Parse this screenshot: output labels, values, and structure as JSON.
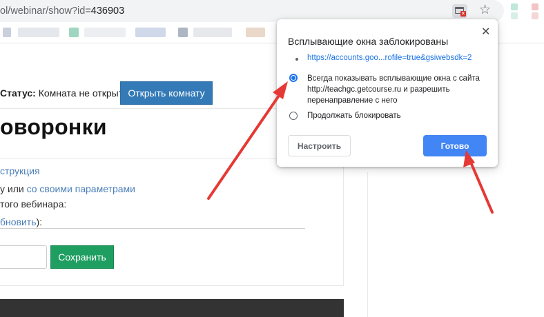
{
  "browser": {
    "url_prefix": "ol/webinar/show?id=",
    "url_id": "436903",
    "popup_icon": "popup-blocked-icon",
    "star_icon": "star-icon"
  },
  "page": {
    "status_label": "Статус:",
    "status_value": "Комната не открыта",
    "open_room_button": "Открыть комнату",
    "title": "оворонки",
    "instruction_link": "струкция",
    "params_prefix": "у или ",
    "params_link": "со своими параметрами",
    "webinar_line": "того вебинара:",
    "update_link": "бновить",
    "update_suffix": "):",
    "save_button": "Сохранить"
  },
  "bubble": {
    "title": "Всплывающие окна заблокированы",
    "close_glyph": "✕",
    "blocked_link": "https://accounts.goo...rofile=true&gsiwebsdk=2",
    "option_always": "Всегда показывать всплывающие окна с сайта http://teachgc.getcourse.ru и разрешить перенаправление с него",
    "option_block": "Продолжать блокировать",
    "configure_button": "Настроить",
    "done_button": "Готово"
  },
  "colors": {
    "accent_blue": "#4285f4",
    "open_room_blue": "#337ab7",
    "save_green": "#1f9e62",
    "annotation_red": "#e53935"
  }
}
